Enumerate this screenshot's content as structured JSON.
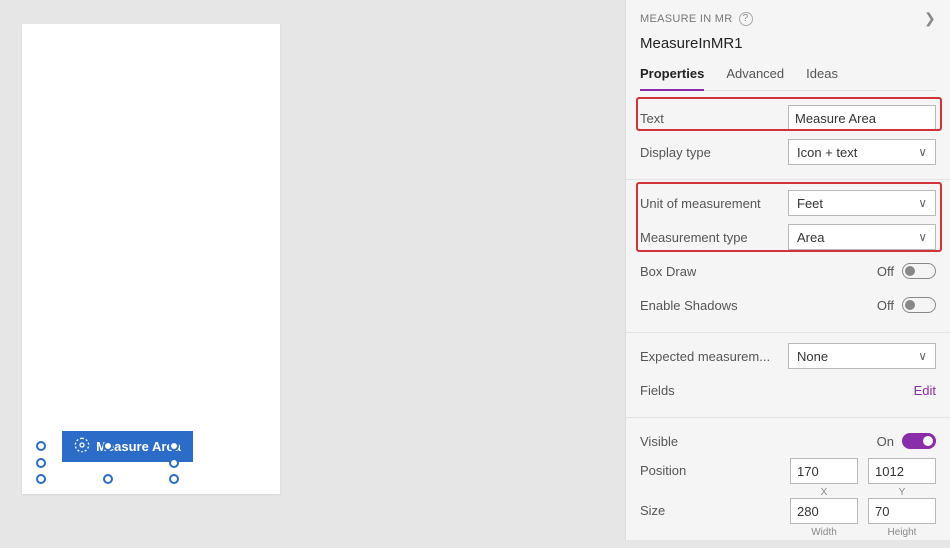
{
  "component_type": "MEASURE IN MR",
  "instance_name": "MeasureInMR1",
  "tabs": {
    "properties": "Properties",
    "advanced": "Advanced",
    "ideas": "Ideas"
  },
  "canvas": {
    "measure_button_label": "Measure Area"
  },
  "props": {
    "text": {
      "label": "Text",
      "value": "Measure Area"
    },
    "display_type": {
      "label": "Display type",
      "value": "Icon + text"
    },
    "unit": {
      "label": "Unit of measurement",
      "value": "Feet"
    },
    "measurement_type": {
      "label": "Measurement type",
      "value": "Area"
    },
    "box_draw": {
      "label": "Box Draw",
      "state": "Off"
    },
    "enable_shadows": {
      "label": "Enable Shadows",
      "state": "Off"
    },
    "expected": {
      "label": "Expected measurem...",
      "value": "None"
    },
    "fields": {
      "label": "Fields",
      "action": "Edit"
    },
    "visible": {
      "label": "Visible",
      "state": "On"
    },
    "position": {
      "label": "Position",
      "x": "170",
      "y": "1012",
      "xlabel": "X",
      "ylabel": "Y"
    },
    "size": {
      "label": "Size",
      "w": "280",
      "h": "70",
      "wlabel": "Width",
      "hlabel": "Height"
    }
  }
}
